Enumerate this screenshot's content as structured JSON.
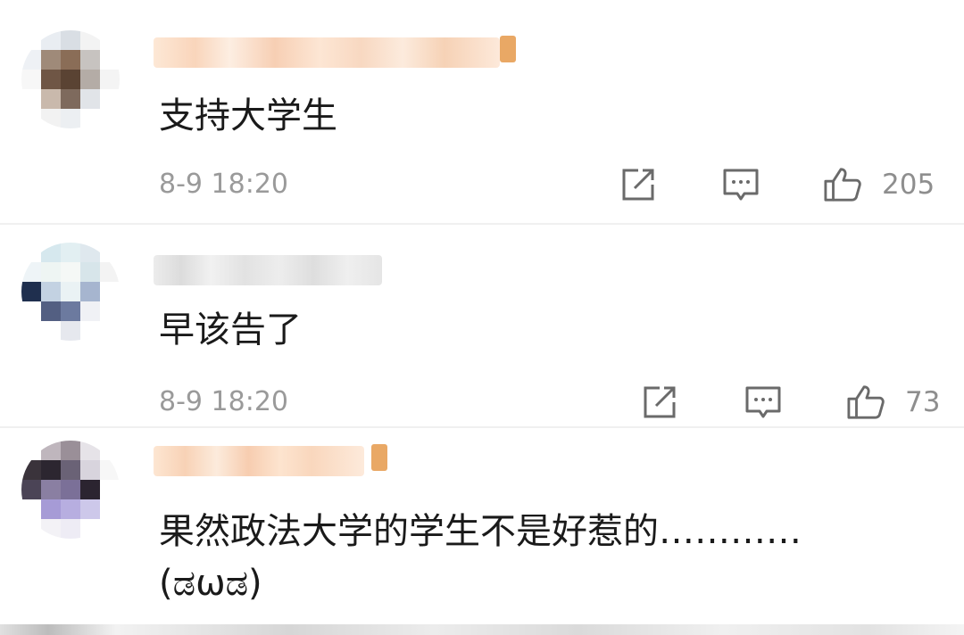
{
  "comments": [
    {
      "text": "支持大学生",
      "time": "8-9 18:20",
      "likes": "205",
      "name_masked": true,
      "has_vip_badge": true,
      "avatar_colors": [
        "#ffffff",
        "#e9edf2",
        "#d9dee4",
        "#f3f3f3",
        "#ffffff",
        "#eef1f5",
        "#9f8a79",
        "#8a6d57",
        "#c7c3c0",
        "#ffffff",
        "#f7f7f7",
        "#6f5645",
        "#5a4333",
        "#b4aca6",
        "#f4f4f4",
        "#ffffff",
        "#c9b9ac",
        "#7e6a5d",
        "#e1e4e8",
        "#ffffff",
        "#ffffff",
        "#f2f2f2",
        "#eceff2",
        "#ffffff",
        "#ffffff"
      ]
    },
    {
      "text": "早该告了",
      "time": "8-9 18:20",
      "likes": "73",
      "name_masked": true,
      "has_vip_badge": false,
      "avatar_colors": [
        "#ffffff",
        "#d6e8ee",
        "#e2eff2",
        "#dfe8ee",
        "#ffffff",
        "#eef4f7",
        "#eef5f3",
        "#f5f8f6",
        "#d7e5ea",
        "#f3f3f3",
        "#1f2f4e",
        "#c3d2e2",
        "#eaf2f4",
        "#a6b5cf",
        "#ffffff",
        "#ffffff",
        "#535f82",
        "#6c7a9f",
        "#f0f1f5",
        "#ffffff",
        "#ffffff",
        "#ffffff",
        "#e6e8ee",
        "#ffffff",
        "#ffffff"
      ]
    },
    {
      "text": "果然政法大学的学生不是好惹的…………",
      "text2": "(ಡωಡ)",
      "name_masked": true,
      "has_vip_badge": true,
      "avatar_colors": [
        "#ffffff",
        "#bfb6bd",
        "#9a8f98",
        "#e6e3e8",
        "#ffffff",
        "#3a333b",
        "#2c2630",
        "#6a6276",
        "#d8d4dd",
        "#f7f7f7",
        "#4b4456",
        "#8a7fa2",
        "#7b7098",
        "#2b2430",
        "#ffffff",
        "#ffffff",
        "#a69bd6",
        "#b7aee0",
        "#cdc8ea",
        "#ffffff",
        "#ffffff",
        "#f3f2f6",
        "#eeecf5",
        "#ffffff",
        "#ffffff"
      ]
    }
  ]
}
